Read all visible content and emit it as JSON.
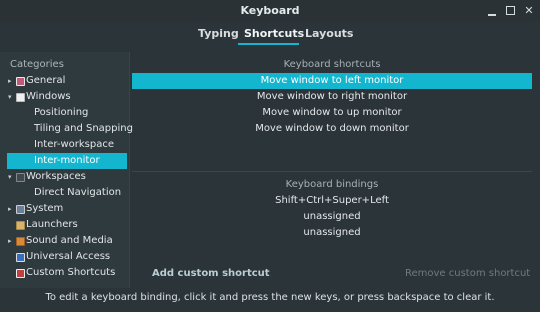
{
  "window": {
    "title": "Keyboard"
  },
  "tabs": [
    {
      "label": "Typing"
    },
    {
      "label": "Shortcuts"
    },
    {
      "label": "Layouts"
    }
  ],
  "sidebar": {
    "header": "Categories",
    "items": [
      {
        "label": "General",
        "icon": "general-icon",
        "arrow": "▸"
      },
      {
        "label": "Windows",
        "icon": "windows-icon",
        "arrow": "▾"
      },
      {
        "label": "Positioning"
      },
      {
        "label": "Tiling and Snapping"
      },
      {
        "label": "Inter-workspace"
      },
      {
        "label": "Inter-monitor"
      },
      {
        "label": "Workspaces",
        "icon": "workspaces-icon",
        "arrow": "▾"
      },
      {
        "label": "Direct Navigation"
      },
      {
        "label": "System",
        "icon": "system-icon",
        "arrow": "▸"
      },
      {
        "label": "Launchers",
        "icon": "launchers-icon"
      },
      {
        "label": "Sound and Media",
        "icon": "sound-icon",
        "arrow": "▸"
      },
      {
        "label": "Universal Access",
        "icon": "universal-access-icon"
      },
      {
        "label": "Custom Shortcuts",
        "icon": "custom-shortcuts-icon"
      }
    ]
  },
  "shortcuts": {
    "header": "Keyboard shortcuts",
    "items": [
      "Move window to left monitor",
      "Move window to right monitor",
      "Move window to up monitor",
      "Move window to down monitor"
    ]
  },
  "bindings": {
    "header": "Keyboard bindings",
    "items": [
      "Shift+Ctrl+Super+Left",
      "unassigned",
      "unassigned"
    ]
  },
  "actions": {
    "add": "Add custom shortcut",
    "remove": "Remove custom shortcut"
  },
  "footer": "To edit a keyboard binding, click it and press the new keys, or press backspace to clear it.",
  "colors": {
    "accent": "#14b6cf",
    "background": "#2b3438"
  }
}
